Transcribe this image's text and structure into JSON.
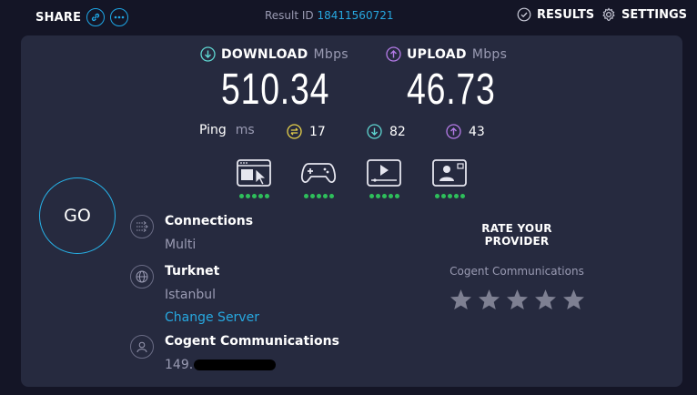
{
  "header": {
    "share_label": "SHARE",
    "result_label": "Result ID",
    "result_id": "18411560721",
    "results_label": "RESULTS",
    "settings_label": "SETTINGS"
  },
  "download": {
    "label": "DOWNLOAD",
    "unit": "Mbps",
    "value": "510.34"
  },
  "upload": {
    "label": "UPLOAD",
    "unit": "Mbps",
    "value": "46.73"
  },
  "ping": {
    "label": "Ping",
    "unit": "ms",
    "idle": "17",
    "download": "82",
    "upload": "43"
  },
  "go_label": "GO",
  "connections": {
    "title": "Connections",
    "value": "Multi"
  },
  "server": {
    "title": "Turknet",
    "location": "Istanbul",
    "change_label": "Change Server"
  },
  "provider": {
    "title": "Cogent Communications",
    "ip": "149."
  },
  "rating": {
    "heading": "RATE YOUR PROVIDER",
    "provider": "Cogent Communications",
    "stars": 5
  },
  "colors": {
    "accent": "#1ea7e6",
    "download": "#5fd6d1",
    "upload": "#b57be8",
    "idle": "#e8d24a",
    "good": "#2ebf5b"
  }
}
